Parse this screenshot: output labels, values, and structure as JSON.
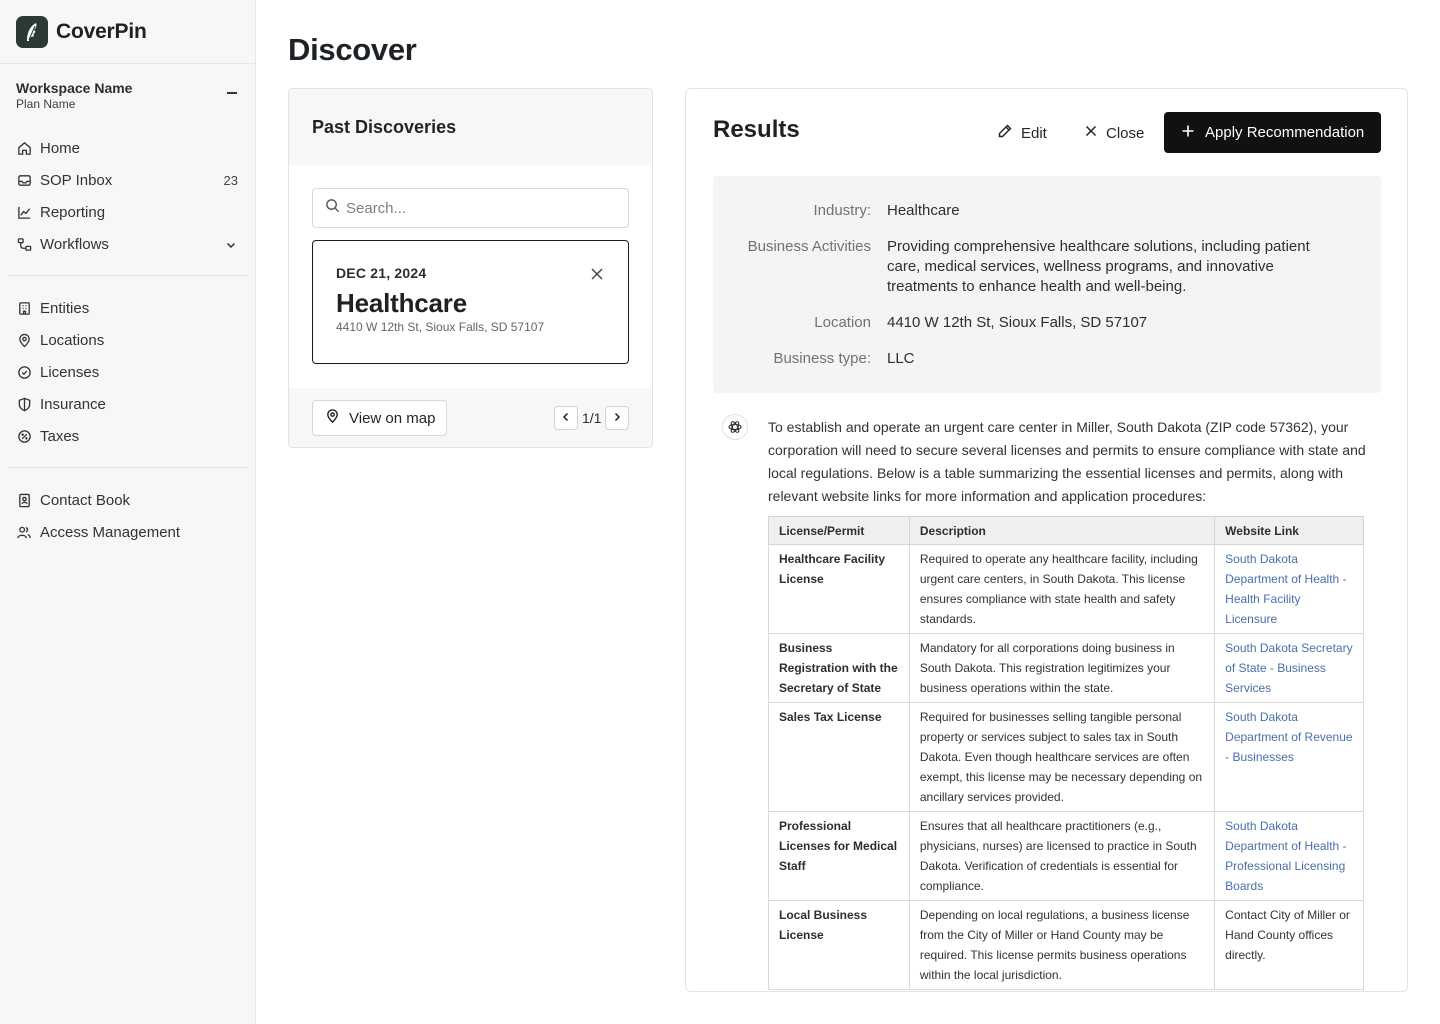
{
  "app": {
    "name": "CoverPin"
  },
  "workspace": {
    "name": "Workspace Name",
    "plan": "Plan Name"
  },
  "nav": {
    "home": "Home",
    "sop_inbox": "SOP Inbox",
    "sop_inbox_count": "23",
    "reporting": "Reporting",
    "workflows": "Workflows",
    "entities": "Entities",
    "locations": "Locations",
    "licenses": "Licenses",
    "insurance": "Insurance",
    "taxes": "Taxes",
    "contact_book": "Contact Book",
    "access_management": "Access Management"
  },
  "page": {
    "title": "Discover"
  },
  "past": {
    "title": "Past Discoveries",
    "search_placeholder": "Search...",
    "card": {
      "date": "DEC 21, 2024",
      "title": "Healthcare",
      "address": "4410 W 12th St, Sioux Falls, SD 57107"
    },
    "view_on_map": "View on map",
    "pager": "1/1"
  },
  "results": {
    "title": "Results",
    "edit": "Edit",
    "close": "Close",
    "apply": "Apply Recommendation",
    "info": {
      "industry_label": "Industry:",
      "industry": "Healthcare",
      "activities_label": "Business Activities",
      "activities": "Providing comprehensive healthcare solutions, including patient care, medical services, wellness programs, and innovative treatments to enhance health and well-being.",
      "location_label": "Location",
      "location": "4410 W 12th St, Sioux Falls, SD 57107",
      "type_label": "Business type:",
      "type": "LLC"
    },
    "intro": "To establish and operate an urgent care center in Miller, South Dakota (ZIP code 57362), your corporation will need to secure several licenses and permits to ensure compliance with state and local regulations. Below is a table summarizing the essential licenses and permits, along with relevant website links for more information and application procedures:",
    "table": {
      "headers": [
        "License/Permit",
        "Description",
        "Website Link"
      ],
      "rows": [
        [
          "Healthcare Facility License",
          "Required to operate any healthcare facility, including urgent care centers, in South Dakota. This license ensures compliance with state health and safety standards.",
          "South Dakota Department of Health - Health Facility Licensure"
        ],
        [
          "Business Registration with the Secretary of State",
          "Mandatory for all corporations doing business in South Dakota. This registration legitimizes your business operations within the state.",
          "South Dakota Secretary of State - Business Services"
        ],
        [
          "Sales Tax License",
          "Required for businesses selling tangible personal property or services subject to sales tax in South Dakota. Even though healthcare services are often exempt, this license may be necessary depending on ancillary services provided.",
          "South Dakota Department of Revenue - Businesses"
        ],
        [
          "Professional Licenses for Medical Staff",
          "Ensures that all healthcare practitioners (e.g., physicians, nurses) are licensed to practice in South Dakota. Verification of credentials is essential for compliance.",
          "South Dakota Department of Health - Professional Licensing Boards"
        ],
        [
          "Local Business License",
          "Depending on local regulations, a business license from the City of Miller or Hand County may be required. This license permits business operations within the local jurisdiction.",
          "Contact City of Miller or Hand County offices directly."
        ]
      ]
    }
  }
}
